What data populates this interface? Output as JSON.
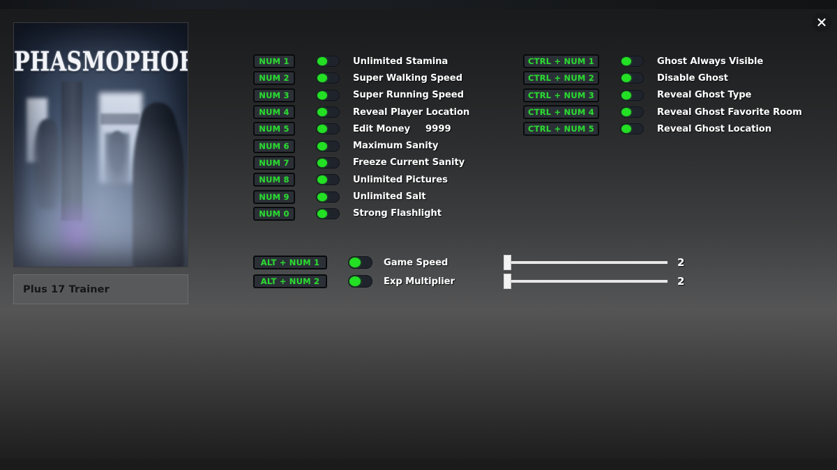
{
  "window": {
    "close_icon": "close-icon"
  },
  "game": {
    "title": "PHASMOPHOBIA",
    "trainer_label": "Plus 17 Trainer",
    "cover_alt": "foggy-hallway-with-ghost-silhouettes"
  },
  "columns": {
    "left": [
      {
        "hotkey": "NUM 1",
        "label": "Unlimited Stamina",
        "enabled": true
      },
      {
        "hotkey": "NUM 2",
        "label": "Super Walking Speed",
        "enabled": true
      },
      {
        "hotkey": "NUM 3",
        "label": "Super Running Speed",
        "enabled": true
      },
      {
        "hotkey": "NUM 4",
        "label": "Reveal Player Location",
        "enabled": true
      },
      {
        "hotkey": "NUM 5",
        "label": "Edit Money",
        "enabled": true,
        "value": "9999"
      },
      {
        "hotkey": "NUM 6",
        "label": "Maximum Sanity",
        "enabled": true
      },
      {
        "hotkey": "NUM 7",
        "label": "Freeze Current Sanity",
        "enabled": true
      },
      {
        "hotkey": "NUM 8",
        "label": "Unlimited Pictures",
        "enabled": true
      },
      {
        "hotkey": "NUM 9",
        "label": "Unlimited Salt",
        "enabled": true
      },
      {
        "hotkey": "NUM 0",
        "label": "Strong Flashlight",
        "enabled": true
      }
    ],
    "right": [
      {
        "hotkey": "CTRL + NUM 1",
        "label": "Ghost Always Visible",
        "enabled": true
      },
      {
        "hotkey": "CTRL + NUM 2",
        "label": "Disable Ghost",
        "enabled": true
      },
      {
        "hotkey": "CTRL + NUM 3",
        "label": "Reveal Ghost Type",
        "enabled": true
      },
      {
        "hotkey": "CTRL + NUM 4",
        "label": "Reveal Ghost Favorite Room",
        "enabled": true
      },
      {
        "hotkey": "CTRL + NUM 5",
        "label": "Reveal Ghost Location",
        "enabled": true
      }
    ]
  },
  "sliders": [
    {
      "hotkey": "ALT + NUM 1",
      "label": "Game Speed",
      "enabled": true,
      "value": "2",
      "percent": 0
    },
    {
      "hotkey": "ALT + NUM 2",
      "label": "Exp Multiplier",
      "enabled": true,
      "value": "2",
      "percent": 0
    }
  ],
  "colors": {
    "hotkey_text": "#2bd832",
    "toggle_on": "#23e024",
    "label_text": "#ffffff",
    "hotkey_bg": "#2b3036",
    "plate_bg": "#57595a"
  }
}
